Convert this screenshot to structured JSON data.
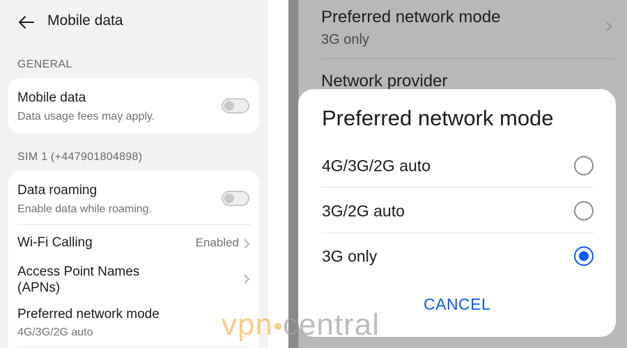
{
  "left": {
    "header": {
      "title": "Mobile data"
    },
    "general_section": "GENERAL",
    "mobile_data": {
      "title": "Mobile data",
      "subtitle": "Data usage fees may apply.",
      "enabled": false
    },
    "sim_section": "SIM 1 (+447901804898)",
    "data_roaming": {
      "title": "Data roaming",
      "subtitle": "Enable data while roaming.",
      "enabled": false
    },
    "wifi_calling": {
      "title": "Wi-Fi Calling",
      "value": "Enabled"
    },
    "apn": {
      "title_line1": "Access Point Names",
      "title_line2": "(APNs)"
    },
    "preferred_mode": {
      "title": "Preferred network mode",
      "value": "4G/3G/2G auto"
    }
  },
  "right": {
    "background": {
      "preferred_mode": {
        "title": "Preferred network mode",
        "value": "3G only"
      },
      "network_provider": {
        "title": "Network provider"
      }
    },
    "dialog": {
      "title": "Preferred network mode",
      "options": [
        {
          "label": "4G/3G/2G auto",
          "selected": false
        },
        {
          "label": "3G/2G auto",
          "selected": false
        },
        {
          "label": "3G only",
          "selected": true
        }
      ],
      "cancel": "CANCEL"
    }
  },
  "watermark": {
    "part1": "vpn",
    "part2": "central"
  },
  "colors": {
    "accent": "#0a59f7",
    "watermark_orange": "#f5a623"
  }
}
